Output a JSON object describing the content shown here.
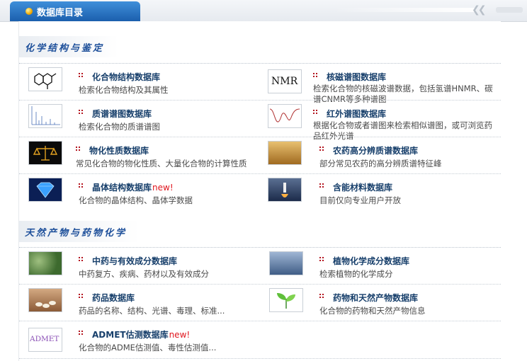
{
  "header": {
    "title": "数据库目录"
  },
  "sections": [
    {
      "title": "化学结构与鉴定",
      "entries": [
        {
          "name": "化合物结构数据库",
          "desc": "检索化合物结构及其属性",
          "icon": "chemical-structure-icon"
        },
        {
          "name": "核磁谱图数据库",
          "desc": "检索化合物的核磁波谱数据，包括氢谱HNMR、碳谱CNMR等多种谱图",
          "icon": "nmr-icon",
          "thumb_text": "NMR"
        },
        {
          "name": "质谱谱图数据库",
          "desc": "检索化合物的质谱谱图",
          "icon": "mass-spectrum-icon"
        },
        {
          "name": "红外谱图数据库",
          "desc": "根据化合物或者谱图来检索相似谱图，或可浏览药品红外光谱",
          "icon": "infrared-spectrum-icon"
        },
        {
          "name": "物化性质数据库",
          "desc": "常见化合物的物化性质、大量化合物的计算性质",
          "icon": "balance-scale-icon"
        },
        {
          "name": "农药高分辨质谱数据库",
          "desc": "部分常见农药的高分辨质谱特征峰",
          "icon": "pesticide-field-icon"
        },
        {
          "name": "晶体结构数据库",
          "new": "new!",
          "desc": "化合物的晶体结构、晶体学数据",
          "icon": "crystal-diamond-icon"
        },
        {
          "name": "含能材料数据库",
          "desc": "目前仅向专业用户开放",
          "icon": "rocket-launch-icon"
        }
      ]
    },
    {
      "title": "天然产物与药物化学",
      "entries": [
        {
          "name": "中药与有效成分数据库",
          "desc": "中药复方、疾病、药材以及有效成分",
          "icon": "herb-plant-icon"
        },
        {
          "name": "植物化学成分数据库",
          "desc": "检索植物的化学成分",
          "icon": "plant-tree-icon"
        },
        {
          "name": "药品数据库",
          "desc": "药品的名称、结构、光谱、毒理、标准...",
          "icon": "pill-bottle-icon"
        },
        {
          "name": "药物和天然产物数据库",
          "desc": "化合物的药物和天然产物信息",
          "icon": "sprout-icon"
        },
        {
          "name": "ADMET估测数据库",
          "new": "new!",
          "desc": "化合物的ADME估测值、毒性估测值...",
          "icon": "admet-icon",
          "thumb_text": "ADMET"
        }
      ]
    }
  ]
}
